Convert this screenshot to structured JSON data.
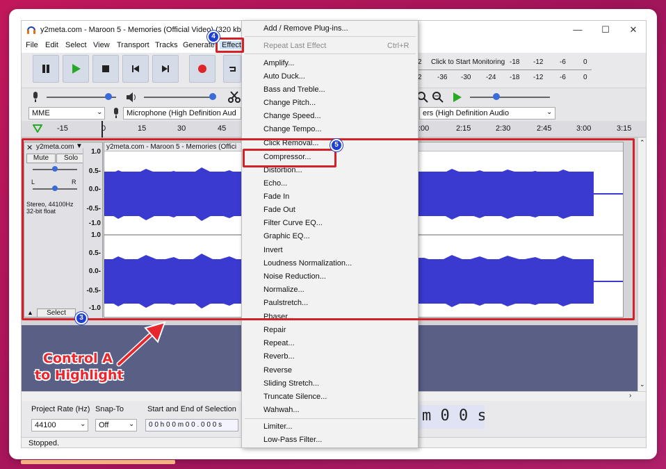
{
  "window": {
    "title": "y2meta.com - Maroon 5 - Memories (Official Video) (320 kbps)",
    "minimize": "—",
    "maximize": "☐",
    "close": "✕"
  },
  "menubar": [
    "File",
    "Edit",
    "Select",
    "View",
    "Transport",
    "Tracks",
    "Generate",
    "Effect"
  ],
  "meters": {
    "row1": [
      "2",
      "Click to Start Monitoring",
      "-18",
      "-12",
      "-6",
      "0"
    ],
    "row2": [
      "2",
      "-36",
      "-30",
      "-24",
      "-18",
      "-12",
      "-6",
      "0"
    ]
  },
  "device": {
    "host": "MME",
    "mic": "Microphone (High Definition Aud",
    "speakers": "ers (High Definition Audio"
  },
  "ruler": [
    "-15",
    "0",
    "15",
    "30",
    "45",
    ":00",
    "2:15",
    "2:30",
    "2:45",
    "3:00",
    "3:15"
  ],
  "track": {
    "name": "y2meta.com",
    "mute": "Mute",
    "solo": "Solo",
    "left": "L",
    "right": "R",
    "info1": "Stereo, 44100Hz",
    "info2": "32-bit float",
    "select": "Select",
    "clip_title": "y2meta.com - Maroon 5 - Memories (Offici",
    "scale": [
      "1.0",
      "0.5-",
      "0.0-",
      "-0.5-",
      "-1.0",
      "1.0",
      "0.5-",
      "0.0-",
      "-0.5-",
      "-1.0"
    ]
  },
  "effect_menu": {
    "items": [
      {
        "label": "Add / Remove Plug-ins...",
        "disabled": false
      },
      {
        "label": "Repeat Last Effect",
        "shortcut": "Ctrl+R",
        "disabled": true
      },
      {
        "label": "Amplify...",
        "disabled": false
      },
      {
        "label": "Auto Duck...",
        "disabled": false
      },
      {
        "label": "Bass and Treble...",
        "disabled": false
      },
      {
        "label": "Change Pitch...",
        "disabled": false
      },
      {
        "label": "Change Speed...",
        "disabled": false
      },
      {
        "label": "Change Tempo...",
        "disabled": false
      },
      {
        "label": "Click Removal...",
        "disabled": false
      },
      {
        "label": "Compressor...",
        "disabled": false
      },
      {
        "label": "Distortion...",
        "disabled": false
      },
      {
        "label": "Echo...",
        "disabled": false
      },
      {
        "label": "Fade In",
        "disabled": false
      },
      {
        "label": "Fade Out",
        "disabled": false
      },
      {
        "label": "Filter Curve EQ...",
        "disabled": false
      },
      {
        "label": "Graphic EQ...",
        "disabled": false
      },
      {
        "label": "Invert",
        "disabled": false
      },
      {
        "label": "Loudness Normalization...",
        "disabled": false
      },
      {
        "label": "Noise Reduction...",
        "disabled": false
      },
      {
        "label": "Normalize...",
        "disabled": false
      },
      {
        "label": "Paulstretch...",
        "disabled": false
      },
      {
        "label": "Phaser...",
        "disabled": false
      },
      {
        "label": "Repair",
        "disabled": false
      },
      {
        "label": "Repeat...",
        "disabled": false
      },
      {
        "label": "Reverb...",
        "disabled": false
      },
      {
        "label": "Reverse",
        "disabled": false
      },
      {
        "label": "Sliding Stretch...",
        "disabled": false
      },
      {
        "label": "Truncate Silence...",
        "disabled": false
      },
      {
        "label": "Wahwah...",
        "disabled": false
      },
      {
        "label": "Limiter...",
        "disabled": false
      },
      {
        "label": "Low-Pass Filter...",
        "disabled": false
      }
    ]
  },
  "bottom": {
    "project_rate_label": "Project Rate (Hz)",
    "snap_label": "Snap-To",
    "selection_label": "Start and End of Selection",
    "rate": "44100",
    "snap": "Off",
    "sel_time": "0 0 h 0 0 m 0 0 . 0 0 0 s",
    "big_time": "m 0 0 s"
  },
  "status": "Stopped.",
  "annotations": {
    "badge3": "3",
    "badge4": "4",
    "badge5": "5",
    "callout_line1": "Control A",
    "callout_line2": "to Highlight"
  },
  "colors": {
    "waveform": "#3a3ad0",
    "highlight": "#d42027",
    "badge": "#1f3fd0",
    "background": "#a0145a"
  }
}
